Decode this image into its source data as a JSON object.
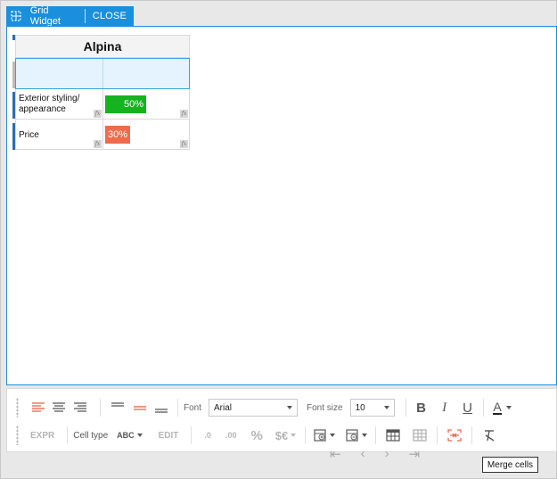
{
  "header": {
    "title": "Grid Widget",
    "close_label": "CLOSE",
    "accent": "#1a8fdc"
  },
  "grid": {
    "title": "Alpina",
    "rows": [
      {
        "label": "",
        "value": "",
        "selected": true
      },
      {
        "label": "Exterior styling/ appearance",
        "value": "50%",
        "bar_fraction": 0.5,
        "bar_color": "#16b21f"
      },
      {
        "label": "Price",
        "value": "30%",
        "bar_fraction": 0.3,
        "bar_color": "#ee6b4c"
      }
    ],
    "formula_icon": "fx"
  },
  "toolbar": {
    "font_label": "Font",
    "font_value": "Arial",
    "font_size_label": "Font size",
    "font_size_value": "10",
    "bold": "B",
    "italic": "I",
    "underline": "U",
    "font_color_glyph": "A",
    "expr_label": "EXPR",
    "cell_type_label": "Cell type",
    "cell_type_value": "ABC",
    "edit_label": "EDIT",
    "percent": "%",
    "currency": "$€",
    "decimal_decrease": ".0",
    "decimal_increase": ".00"
  },
  "tooltip": {
    "text": "Merge cells"
  },
  "icons": {
    "grid": "grid-widget-icon",
    "align_left": "align-left-icon",
    "align_center": "align-center-icon",
    "align_right": "align-right-icon",
    "valign_top": "valign-top-icon",
    "valign_middle": "valign-middle-icon",
    "valign_bottom": "valign-bottom-icon",
    "merge": "merge-cells-icon",
    "clear_format": "clear-format-icon"
  }
}
